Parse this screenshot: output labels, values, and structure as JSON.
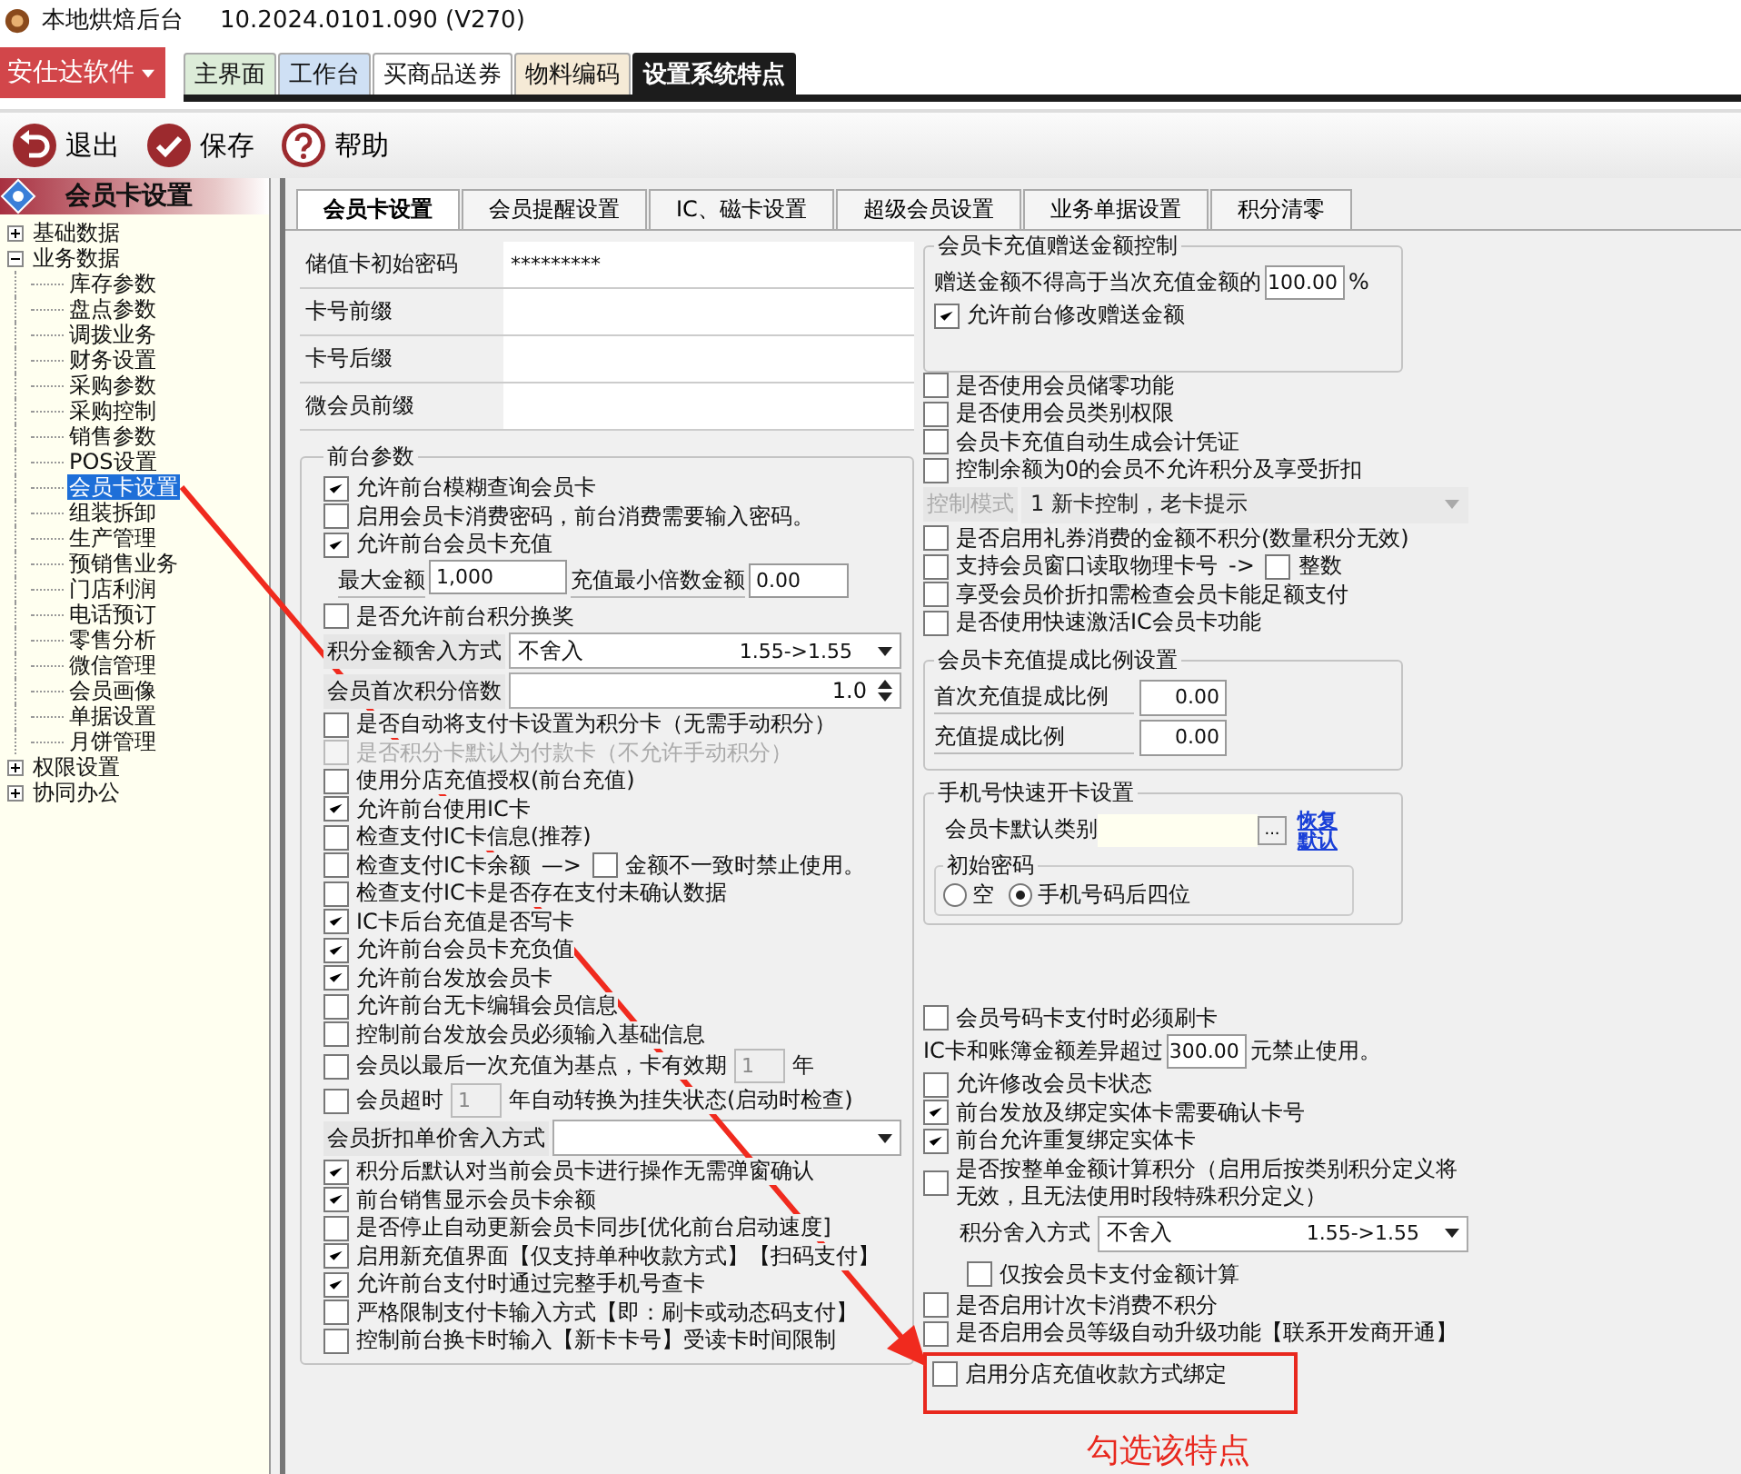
{
  "window": {
    "title": "本地烘焙后台",
    "version": "10.2024.0101.090 (V270)"
  },
  "menu_button": "安仕达软件",
  "top_tabs": [
    {
      "label": "主界面",
      "color": "#dcecd8",
      "selected": false
    },
    {
      "label": "工作台",
      "color": "#cfe0f4",
      "selected": false
    },
    {
      "label": "买商品送券",
      "color": "#ffffff",
      "selected": false
    },
    {
      "label": "物料编码",
      "color": "#f5ead6",
      "selected": false
    },
    {
      "label": "设置系统特点",
      "color": "#1c1c1c",
      "selected": true
    }
  ],
  "toolbar": [
    {
      "label": "退出",
      "kind": "exit"
    },
    {
      "label": "保存",
      "kind": "save"
    },
    {
      "label": "帮助",
      "kind": "help"
    }
  ],
  "sidebar": {
    "title": "会员卡设置",
    "tree": [
      {
        "label": "基础数据",
        "expanded": false
      },
      {
        "label": "业务数据",
        "expanded": true,
        "children": [
          {
            "label": "库存参数",
            "selected": false
          },
          {
            "label": "盘点参数",
            "selected": false
          },
          {
            "label": "调拨业务",
            "selected": false
          },
          {
            "label": "财务设置",
            "selected": false
          },
          {
            "label": "采购参数",
            "selected": false
          },
          {
            "label": "采购控制",
            "selected": false
          },
          {
            "label": "销售参数",
            "selected": false
          },
          {
            "label": "POS设置",
            "selected": false
          },
          {
            "label": "会员卡设置",
            "selected": true
          },
          {
            "label": "组装拆卸",
            "selected": false
          },
          {
            "label": "生产管理",
            "selected": false
          },
          {
            "label": "预销售业务",
            "selected": false
          },
          {
            "label": "门店利润",
            "selected": false
          },
          {
            "label": "电话预订",
            "selected": false
          },
          {
            "label": "零售分析",
            "selected": false
          },
          {
            "label": "微信管理",
            "selected": false
          },
          {
            "label": "会员画像",
            "selected": false
          },
          {
            "label": "单据设置",
            "selected": false
          },
          {
            "label": "月饼管理",
            "selected": false
          }
        ]
      },
      {
        "label": "权限设置",
        "expanded": false
      },
      {
        "label": "协同办公",
        "expanded": false
      }
    ]
  },
  "tabs": [
    {
      "label": "会员卡设置",
      "selected": true
    },
    {
      "label": "会员提醒设置",
      "selected": false
    },
    {
      "label": "IC、磁卡设置",
      "selected": false
    },
    {
      "label": "超级会员设置",
      "selected": false
    },
    {
      "label": "业务单据设置",
      "selected": false
    },
    {
      "label": "积分清零",
      "selected": false
    }
  ],
  "left_column": [
    {
      "kind": "field",
      "label": "储值卡初始密码",
      "value": "*********"
    },
    {
      "kind": "field",
      "label": "卡号前缀"
    },
    {
      "kind": "field",
      "label": "卡号后缀"
    },
    {
      "kind": "field",
      "label": "微会员前缀"
    },
    {
      "kind": "group",
      "title": "前台参数",
      "items": [
        {
          "kind": "check",
          "label": "允许前台模糊查询会员卡",
          "checked": true,
          "disabled": false
        },
        {
          "kind": "check",
          "label": "启用会员卡消费密码，前台消费需要输入密码。",
          "checked": false,
          "disabled": false
        },
        {
          "kind": "check",
          "label": "允许前台会员卡充值",
          "checked": true,
          "disabled": false
        },
        {
          "kind": "pair",
          "label": "最大金额",
          "value": "1,000",
          "label2": "充值最小倍数金额",
          "value2": "0.00"
        },
        {
          "kind": "check",
          "label": "是否允许前台积分换奖",
          "checked": false,
          "disabled": false
        },
        {
          "kind": "select",
          "label": "积分金额舍入方式",
          "value": "不舍入",
          "example": "1.55->1.55",
          "disabled": false
        },
        {
          "kind": "spinner",
          "label": "会员首次积分倍数",
          "value": "1.0"
        },
        {
          "kind": "check",
          "label": "是否自动将支付卡设置为积分卡（无需手动积分）",
          "checked": false,
          "disabled": false
        },
        {
          "kind": "check",
          "label": "是否积分卡默认为付款卡（不允许手动积分）",
          "checked": false,
          "disabled": true
        },
        {
          "kind": "check",
          "label": "使用分店充值授权(前台充值)",
          "checked": false,
          "disabled": false
        },
        {
          "kind": "check",
          "label": "允许前台使用IC卡",
          "checked": true,
          "disabled": false
        },
        {
          "kind": "check",
          "label": "检查支付IC卡信息(推荐)",
          "checked": false,
          "disabled": false
        },
        {
          "kind": "chain",
          "label": "检查支付IC卡余额",
          "arrow": "—>",
          "label2": "金额不一致时禁止使用。",
          "checked": false,
          "checked2": false,
          "disabled": false
        },
        {
          "kind": "check",
          "label": "检查支付IC卡是否存在支付未确认数据",
          "checked": false,
          "disabled": false
        },
        {
          "kind": "check",
          "label": "IC卡后台充值是否写卡",
          "checked": true,
          "disabled": false
        },
        {
          "kind": "check",
          "label": "允许前台会员卡充负值",
          "checked": true,
          "disabled": false
        },
        {
          "kind": "check",
          "label": "允许前台发放会员卡",
          "checked": true,
          "disabled": false
        },
        {
          "kind": "check",
          "label": "允许前台无卡编辑会员信息",
          "checked": false,
          "disabled": false
        },
        {
          "kind": "check",
          "label": "控制前台发放会员必须输入基础信息",
          "checked": false,
          "disabled": false
        },
        {
          "kind": "check_input",
          "label": "会员以最后一次充值为基点，卡有效期",
          "value": "1",
          "suffix": "年",
          "checked": false,
          "disabled": false
        },
        {
          "kind": "check_input",
          "label": "会员超时",
          "value": "1",
          "suffix": "年自动转换为挂失状态(启动时检查)",
          "checked": false,
          "disabled": false
        },
        {
          "kind": "select",
          "label": "会员折扣单价舍入方式",
          "disabled": false
        },
        {
          "kind": "check",
          "label": "积分后默认对当前会员卡进行操作无需弹窗确认",
          "checked": true,
          "disabled": false
        },
        {
          "kind": "check",
          "label": "前台销售显示会员卡余额",
          "checked": true,
          "disabled": false
        },
        {
          "kind": "check",
          "label": "是否停止自动更新会员卡同步[优化前台启动速度]",
          "checked": false,
          "disabled": false
        },
        {
          "kind": "check",
          "label": "启用新充值界面【仅支持单种收款方式】【扫码支付】",
          "checked": true,
          "disabled": false
        },
        {
          "kind": "check",
          "label": "允许前台支付时通过完整手机号查卡",
          "checked": true,
          "disabled": false
        },
        {
          "kind": "check",
          "label": "严格限制支付卡输入方式【即：刷卡或动态码支付】",
          "checked": false,
          "disabled": false
        },
        {
          "kind": "check",
          "label": "控制前台换卡时输入【新卡卡号】受读卡时间限制",
          "checked": false,
          "disabled": false
        }
      ]
    }
  ],
  "right_column": [
    {
      "kind": "group",
      "title": "会员卡充值赠送金额控制",
      "items": [
        {
          "kind": "input_row",
          "label": "赠送金额不得高于当次充值金额的",
          "value": "100.00",
          "suffix": "%"
        },
        {
          "kind": "check",
          "label": "允许前台修改赠送金额",
          "checked": true,
          "disabled": false
        }
      ]
    },
    {
      "kind": "check",
      "label": "是否使用会员储零功能",
      "checked": false,
      "disabled": false
    },
    {
      "kind": "check",
      "label": "是否使用会员类别权限",
      "checked": false,
      "disabled": false
    },
    {
      "kind": "check",
      "label": "会员卡充值自动生成会计凭证",
      "checked": false,
      "disabled": false
    },
    {
      "kind": "check",
      "label": "控制余额为0的会员不允许积分及享受折扣",
      "checked": false,
      "disabled": false
    },
    {
      "kind": "select",
      "label": "控制模式",
      "value": "1 新卡控制，老卡提示",
      "disabled": true
    },
    {
      "kind": "check",
      "label": "是否启用礼券消费的金额不积分(数量积分无效)",
      "checked": false,
      "disabled": false
    },
    {
      "kind": "chain",
      "label": "支持会员窗口读取物理卡号",
      "arrow": "->",
      "label2": "整数",
      "checked": false,
      "checked2": false,
      "disabled": false
    },
    {
      "kind": "check",
      "label": "享受会员价折扣需检查会员卡能足额支付",
      "checked": false,
      "disabled": false
    },
    {
      "kind": "check",
      "label": "是否使用快速激活IC会员卡功能",
      "checked": false,
      "disabled": false
    },
    {
      "kind": "group",
      "title": "会员卡充值提成比例设置",
      "items": [
        {
          "kind": "ratio",
          "label": "首次充值提成比例",
          "value": "0.00"
        },
        {
          "kind": "ratio",
          "label": "充值提成比例",
          "value": "0.00"
        }
      ]
    },
    {
      "kind": "group",
      "title": "手机号快速开卡设置",
      "items": [
        {
          "kind": "category",
          "label": "会员卡默认类别",
          "button": "...",
          "link": "恢复默认"
        },
        {
          "kind": "radios",
          "title": "初始密码",
          "options": [
            {
              "label": "空",
              "selected": false
            },
            {
              "label": "手机号码后四位",
              "selected": true
            }
          ]
        }
      ]
    },
    {
      "kind": "check",
      "label": "会员号码卡支付时必须刷卡",
      "checked": false,
      "disabled": false
    },
    {
      "kind": "input_row",
      "label": "IC卡和账簿金额差异超过",
      "value": "300.00",
      "suffix": "元禁止使用。"
    },
    {
      "kind": "check",
      "label": "允许修改会员卡状态",
      "checked": false,
      "disabled": false
    },
    {
      "kind": "check",
      "label": "前台发放及绑定实体卡需要确认卡号",
      "checked": true,
      "disabled": false
    },
    {
      "kind": "check",
      "label": "前台允许重复绑定实体卡",
      "checked": true,
      "disabled": false
    },
    {
      "kind": "check",
      "label": "是否按整单金额计算积分（启用后按类别积分定义将无效，且无法使用时段特殊积分定义）",
      "checked": false,
      "disabled": false
    },
    {
      "kind": "sub_select",
      "label": "积分舍入方式",
      "value": "不舍入",
      "example": "1.55->1.55",
      "disabled": false
    },
    {
      "kind": "sub_check",
      "label": "仅按会员卡支付金额计算",
      "checked": false,
      "disabled": false
    },
    {
      "kind": "check",
      "label": "是否启用计次卡消费不积分",
      "checked": false,
      "disabled": false
    },
    {
      "kind": "check",
      "label": "是否启用会员等级自动升级功能【联系开发商开通】",
      "checked": false,
      "disabled": false
    },
    {
      "kind": "marked_check",
      "label": "启用分店充值收款方式绑定",
      "note": "勾选该特点",
      "checked": false,
      "disabled": false
    }
  ]
}
